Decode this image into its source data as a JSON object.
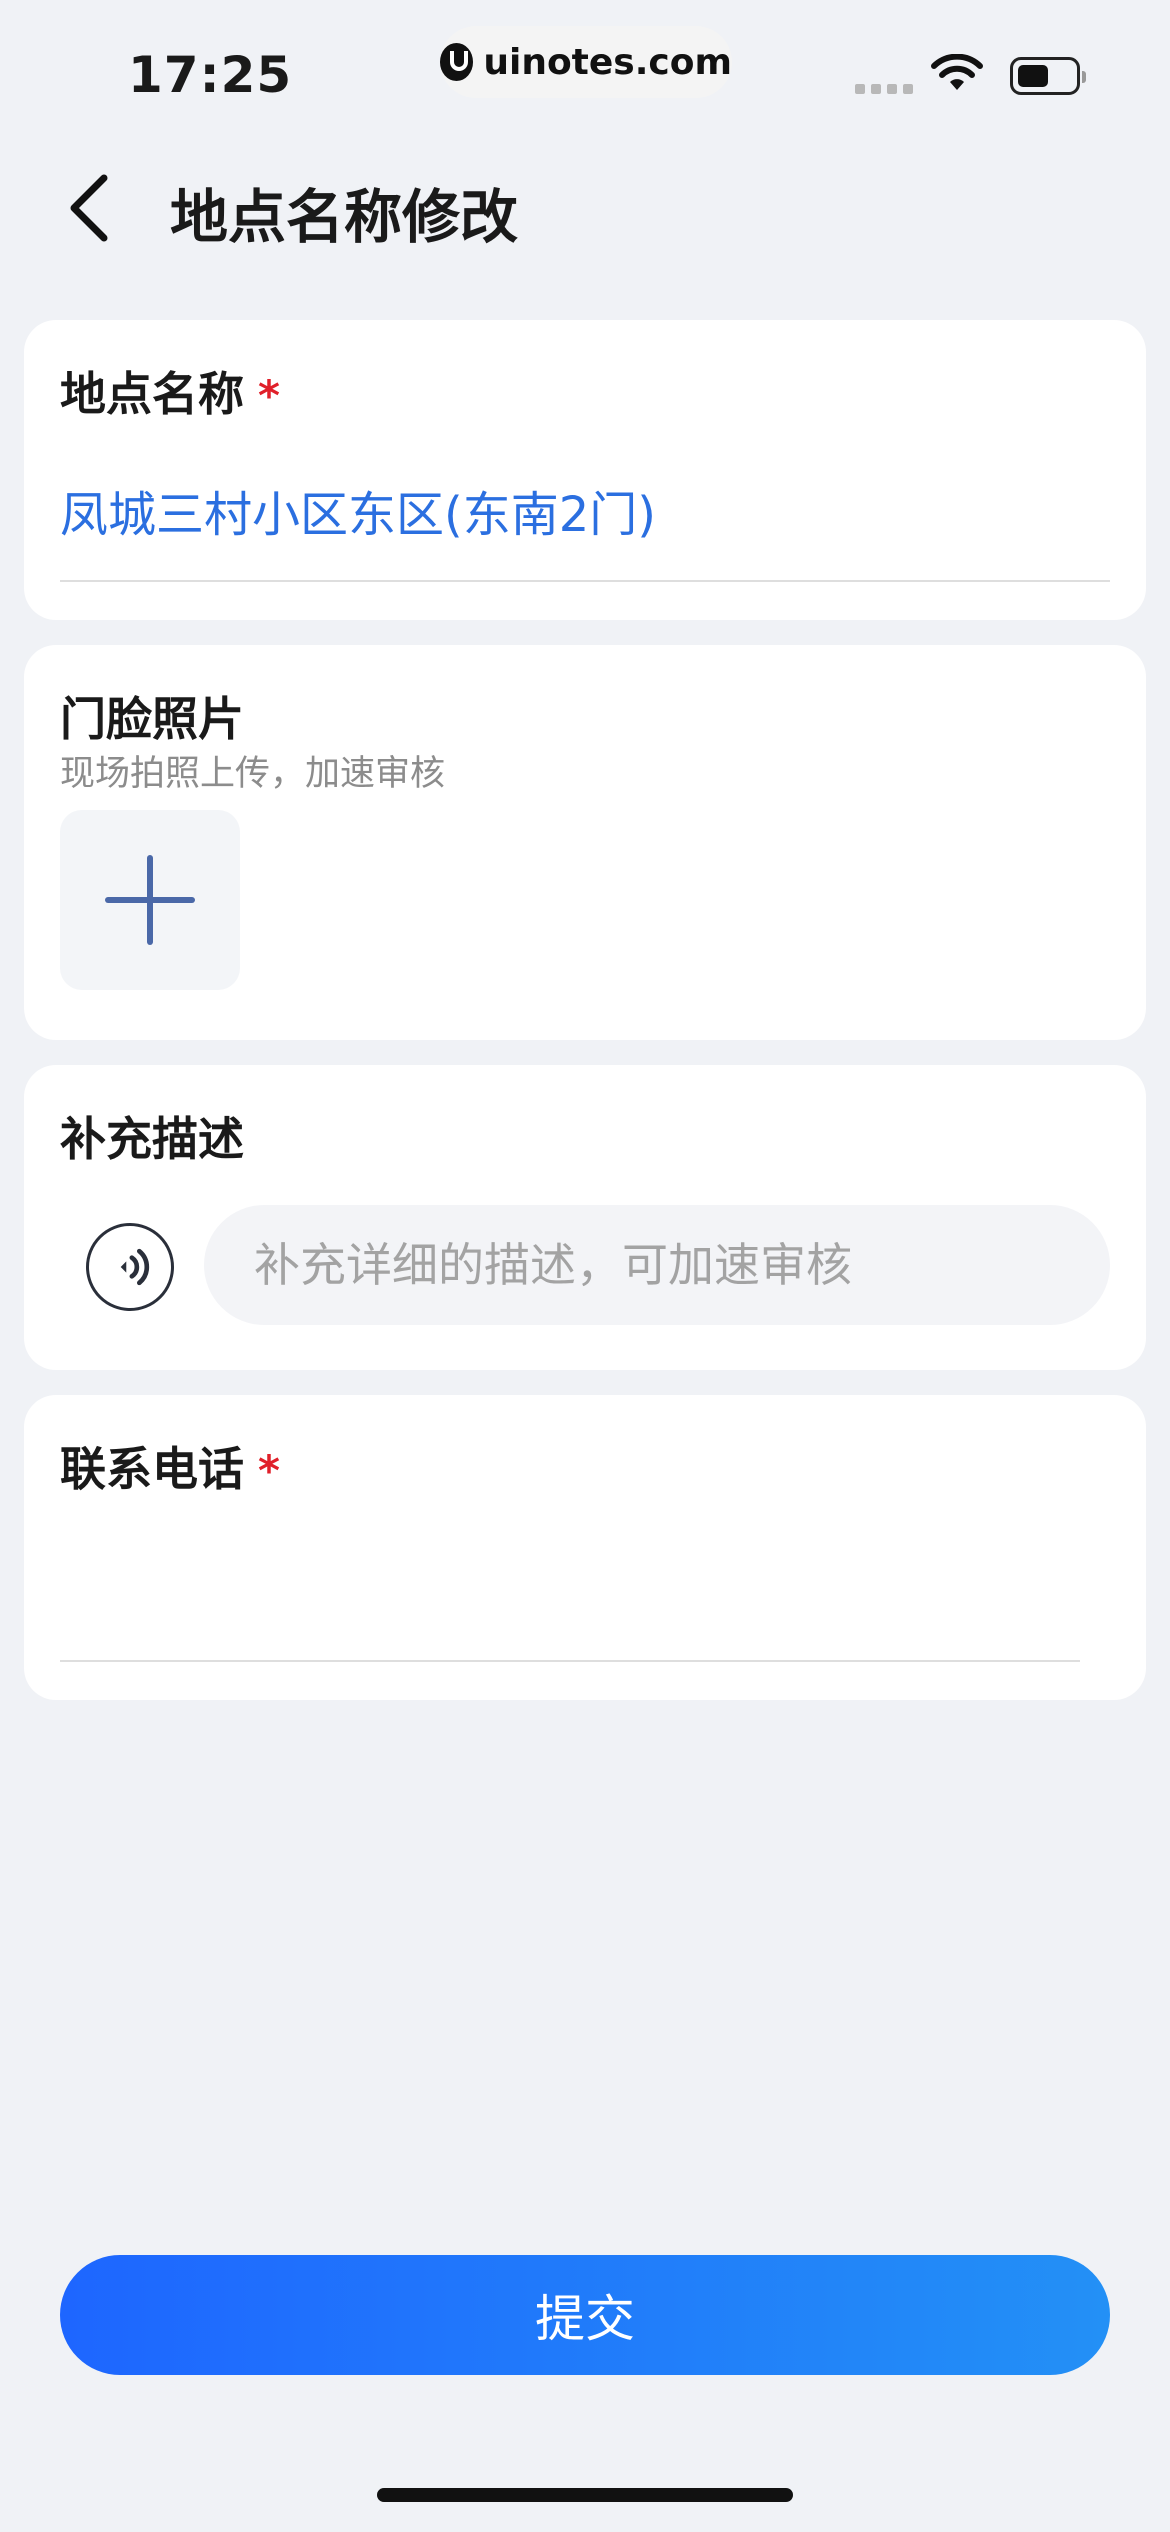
{
  "status_bar": {
    "time": "17:25",
    "url": "uinotes.com",
    "icons": [
      "signal-icon",
      "wifi-icon",
      "battery-icon"
    ]
  },
  "header": {
    "back_icon": "chevron-left-icon",
    "title": "地点名称修改"
  },
  "place_name": {
    "label": "地点名称",
    "required_mark": "*",
    "value": "凤城三村小区东区(东南2门)"
  },
  "door_photo": {
    "label": "门脸照片",
    "hint": "现场拍照上传，加速审核",
    "add_icon": "plus-icon"
  },
  "description": {
    "label": "补充描述",
    "voice_icon": "voice-icon",
    "placeholder": "补充详细的描述，可加速审核",
    "value": ""
  },
  "contact_phone": {
    "label": "联系电话",
    "required_mark": "*",
    "value": ""
  },
  "submit": {
    "label": "提交"
  },
  "colors": {
    "accent": "#2b6fe0",
    "required": "#e0202a",
    "background": "#f0f2f6",
    "button_gradient_start": "#1e66ff",
    "button_gradient_end": "#2390f6"
  }
}
